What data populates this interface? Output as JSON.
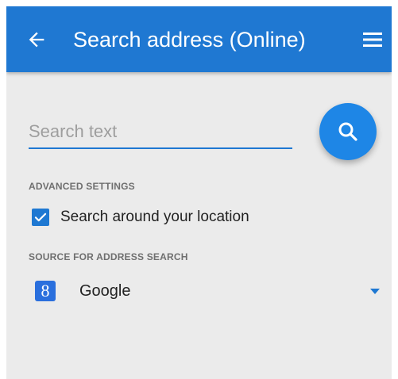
{
  "appbar": {
    "title": "Search address (Online)",
    "back_icon": "arrow-left-icon",
    "menu_icon": "hamburger-menu-icon",
    "color": "#1f78d2"
  },
  "search": {
    "placeholder": "Search text",
    "value": "",
    "button_icon": "search-icon",
    "button_color": "#1e86e6"
  },
  "advanced_settings": {
    "header": "ADVANCED SETTINGS",
    "search_around_location": {
      "label": "Search around your location",
      "checked": true
    }
  },
  "source": {
    "header": "SOURCE FOR ADDRESS SEARCH",
    "selected": "Google",
    "logo_text": "8",
    "logo_icon": "google-logo-icon",
    "dropdown_icon": "dropdown-arrow-icon"
  }
}
